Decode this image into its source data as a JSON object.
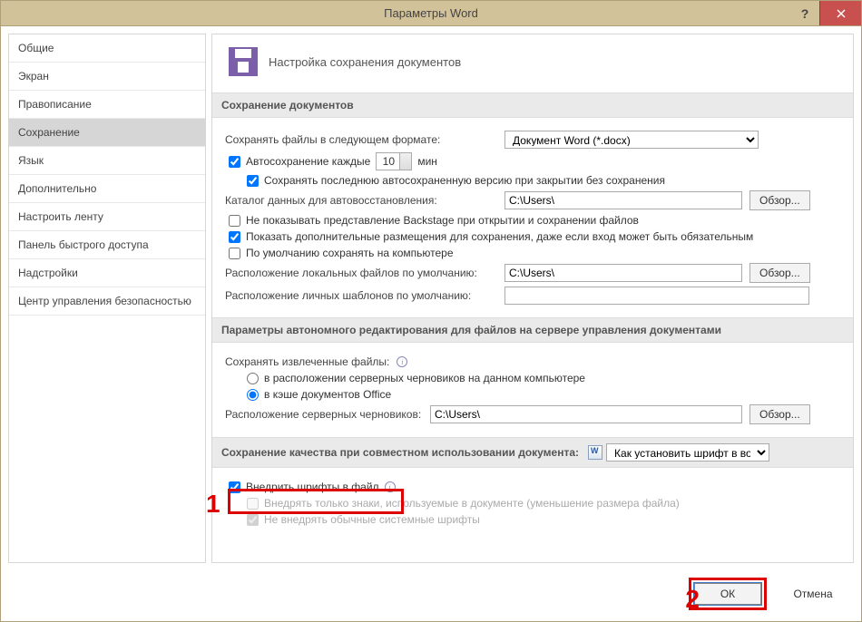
{
  "title": "Параметры Word",
  "sidebar": {
    "items": [
      {
        "label": "Общие"
      },
      {
        "label": "Экран"
      },
      {
        "label": "Правописание"
      },
      {
        "label": "Сохранение"
      },
      {
        "label": "Язык"
      },
      {
        "label": "Дополнительно"
      },
      {
        "label": "Настроить ленту"
      },
      {
        "label": "Панель быстрого доступа"
      },
      {
        "label": "Надстройки"
      },
      {
        "label": "Центр управления безопасностью"
      }
    ],
    "selected_index": 3
  },
  "header": {
    "text": "Настройка сохранения документов"
  },
  "sections": {
    "save_docs": {
      "title": "Сохранение документов",
      "save_format_label": "Сохранять файлы в следующем формате:",
      "save_format_value": "Документ Word (*.docx)",
      "autosave_label": "Автосохранение каждые",
      "autosave_value": "10",
      "autosave_unit": "мин",
      "keep_last_label": "Сохранять последнюю автосохраненную версию при закрытии без сохранения",
      "autorecover_label": "Каталог данных для автовосстановления:",
      "autorecover_value": "C:\\Users\\",
      "browse": "Обзор...",
      "no_backstage_label": "Не показывать представление Backstage при открытии и сохранении файлов",
      "show_additional_label": "Показать дополнительные размещения для сохранения, даже если вход может быть обязательным",
      "save_computer_label": "По умолчанию сохранять на компьютере",
      "local_files_label": "Расположение локальных файлов по умолчанию:",
      "local_files_value": "C:\\Users\\",
      "personal_templates_label": "Расположение личных шаблонов по умолчанию:",
      "personal_templates_value": ""
    },
    "offline": {
      "title": "Параметры автономного редактирования для файлов на сервере управления документами",
      "save_extracted_label": "Сохранять извлеченные файлы:",
      "opt_server_label": "в расположении серверных черновиков на данном компьютере",
      "opt_cache_label": "в кэше документов Office",
      "drafts_label": "Расположение серверных черновиков:",
      "drafts_value": "C:\\Users\\",
      "browse": "Обзор..."
    },
    "fidelity": {
      "title": "Сохранение качества при совместном использовании документа:",
      "doc_value": "Как установить шрифт в ворд",
      "embed_label": "Внедрить шрифты в файл",
      "embed_used_label": "Внедрять только знаки, используемые в документе (уменьшение размера файла)",
      "no_system_label": "Не внедрять обычные системные шрифты"
    }
  },
  "footer": {
    "ok": "ОК",
    "cancel": "Отмена"
  },
  "annotations": {
    "one": "1",
    "two": "2"
  }
}
